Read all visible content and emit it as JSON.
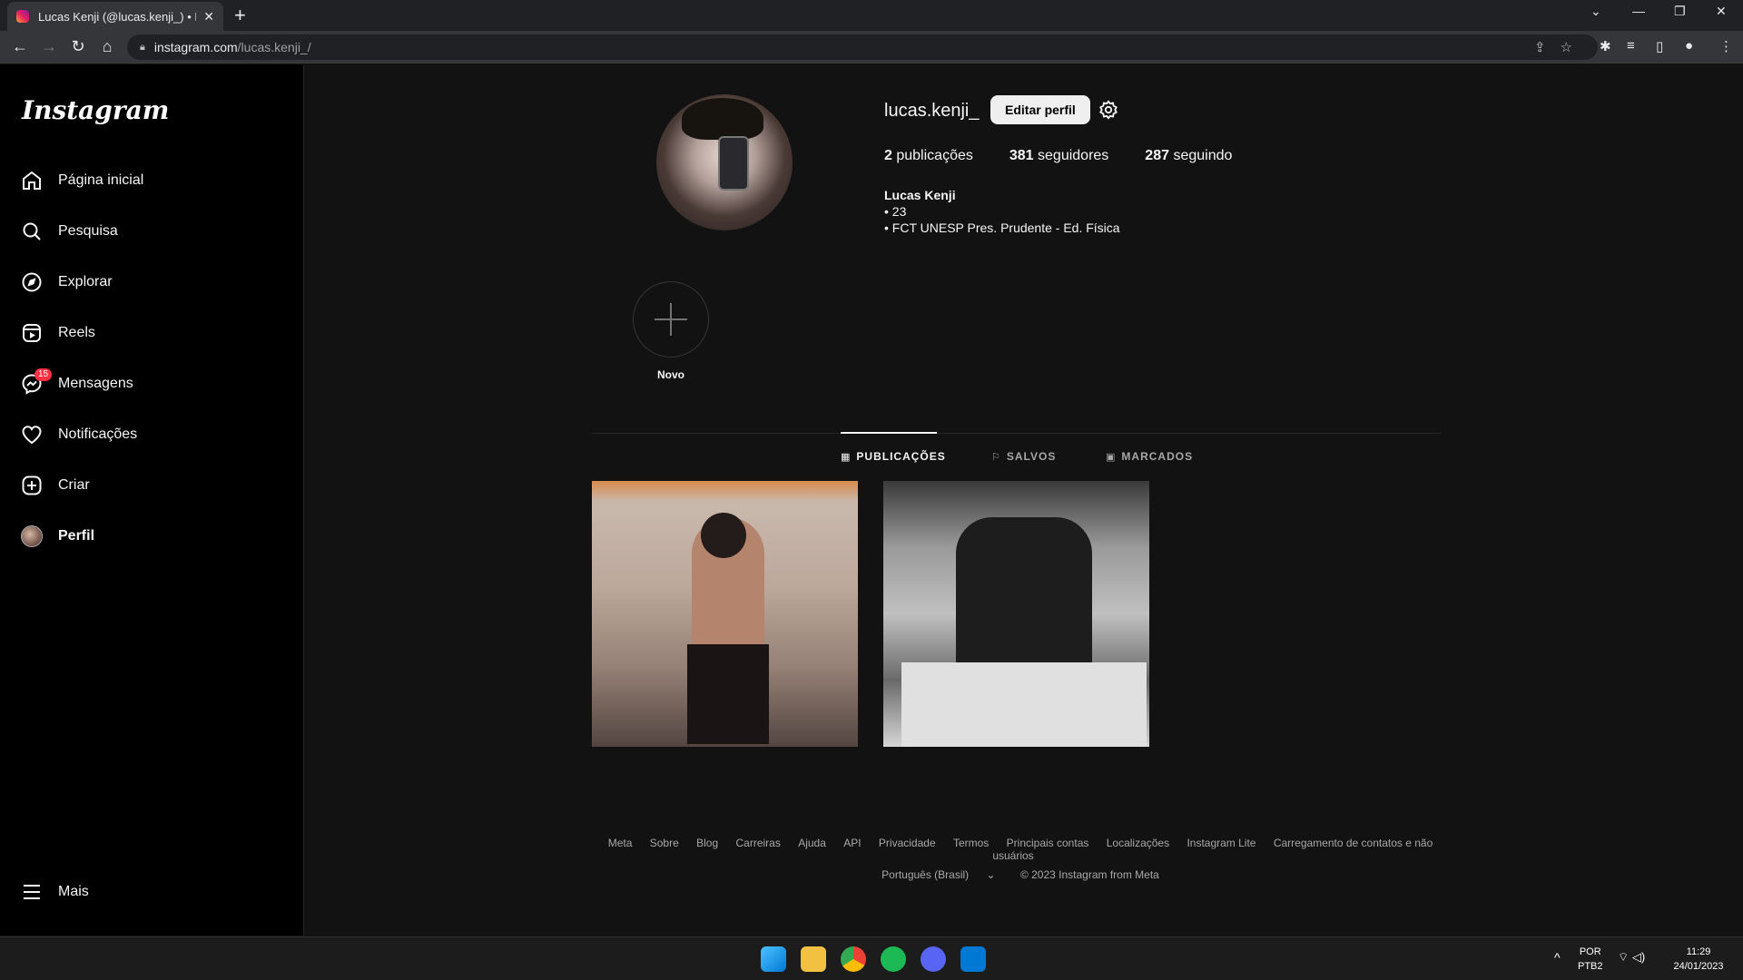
{
  "browser": {
    "tab_title": "Lucas Kenji (@lucas.kenji_) • Foto",
    "url_host": "instagram.com",
    "url_path": "/lucas.kenji_/"
  },
  "sidebar": {
    "logo": "Instagram",
    "items": [
      {
        "label": "Página inicial",
        "icon": "home-icon"
      },
      {
        "label": "Pesquisa",
        "icon": "search-icon"
      },
      {
        "label": "Explorar",
        "icon": "compass-icon"
      },
      {
        "label": "Reels",
        "icon": "reels-icon"
      },
      {
        "label": "Mensagens",
        "icon": "messenger-icon",
        "badge": "15"
      },
      {
        "label": "Notificações",
        "icon": "heart-icon"
      },
      {
        "label": "Criar",
        "icon": "plus-square-icon"
      },
      {
        "label": "Perfil",
        "icon": "avatar"
      }
    ],
    "more": "Mais"
  },
  "profile": {
    "username": "lucas.kenji_",
    "edit_label": "Editar perfil",
    "posts_count": "2",
    "posts_label": "publicações",
    "followers_count": "381",
    "followers_label": "seguidores",
    "following_count": "287",
    "following_label": "seguindo",
    "full_name": "Lucas Kenji",
    "bio_lines": [
      "• 23",
      "• FCT UNESP Pres. Prudente - Ed. Física"
    ]
  },
  "highlights": {
    "new_label": "Novo"
  },
  "tabs": [
    {
      "label": "PUBLICAÇÕES",
      "active": true
    },
    {
      "label": "SALVOS",
      "active": false
    },
    {
      "label": "MARCADOS",
      "active": false
    }
  ],
  "footer": {
    "links": [
      "Meta",
      "Sobre",
      "Blog",
      "Carreiras",
      "Ajuda",
      "API",
      "Privacidade",
      "Termos",
      "Principais contas",
      "Localizações",
      "Instagram Lite",
      "Carregamento de contatos e não usuários"
    ],
    "language": "Português (Brasil)",
    "copyright": "© 2023 Instagram from Meta"
  },
  "taskbar": {
    "lang_top": "POR",
    "lang_bottom": "PTB2",
    "time": "11:29",
    "date": "24/01/2023"
  }
}
